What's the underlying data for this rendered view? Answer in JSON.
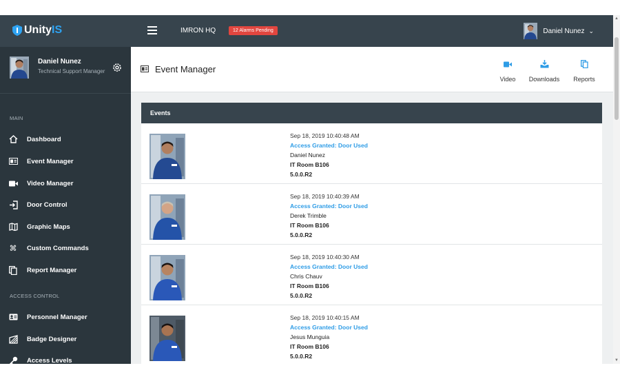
{
  "app": {
    "logo_main": "Unity",
    "logo_accent": "IS"
  },
  "topbar": {
    "site": "IMRON HQ",
    "alarms": "12 Alarms Pending",
    "user": "Daniel Nunez"
  },
  "profile": {
    "name": "Daniel Nunez",
    "role": "Technical Support Manager"
  },
  "sidebar": {
    "main_section": "MAIN",
    "access_section": "ACCESS CONTROL",
    "items": [
      {
        "label": "Dashboard",
        "icon": "home-icon"
      },
      {
        "label": "Event Manager",
        "icon": "event-icon"
      },
      {
        "label": "Video Manager",
        "icon": "video-camera-icon"
      },
      {
        "label": "Door Control",
        "icon": "door-icon"
      },
      {
        "label": "Graphic Maps",
        "icon": "map-icon"
      },
      {
        "label": "Custom Commands",
        "icon": "command-icon"
      },
      {
        "label": "Report Manager",
        "icon": "report-icon"
      },
      {
        "label": "Personnel Manager",
        "icon": "id-card-icon"
      },
      {
        "label": "Badge Designer",
        "icon": "badge-icon"
      },
      {
        "label": "Access Levels",
        "icon": "key-icon"
      }
    ]
  },
  "page": {
    "title": "Event Manager",
    "tools": [
      {
        "label": "Video",
        "icon": "video-camera-icon"
      },
      {
        "label": "Downloads",
        "icon": "download-icon"
      },
      {
        "label": "Reports",
        "icon": "copy-icon"
      }
    ]
  },
  "events": {
    "heading": "Events",
    "rows": [
      {
        "timestamp": "Sep 18, 2019 10:40:48 AM",
        "event": "Access Granted: Door Used",
        "person": "Daniel Nunez",
        "location": "IT Room B106",
        "version": "5.0.0.R2"
      },
      {
        "timestamp": "Sep 18, 2019 10:40:39 AM",
        "event": "Access Granted: Door Used",
        "person": "Derek Trimble",
        "location": "IT Room B106",
        "version": "5.0.0.R2"
      },
      {
        "timestamp": "Sep 18, 2019 10:40:30 AM",
        "event": "Access Granted: Door Used",
        "person": "Chris Chauv",
        "location": "IT Room B106",
        "version": "5.0.0.R2"
      },
      {
        "timestamp": "Sep 18, 2019 10:40:15 AM",
        "event": "Access Granted: Door Used",
        "person": "Jesus Munguia",
        "location": "IT Room B106",
        "version": "5.0.0.R2"
      }
    ]
  },
  "colors": {
    "topbar": "#37444d",
    "sidebar": "#2b363d",
    "accent": "#2e9ce6",
    "alarm": "#e2463f"
  }
}
